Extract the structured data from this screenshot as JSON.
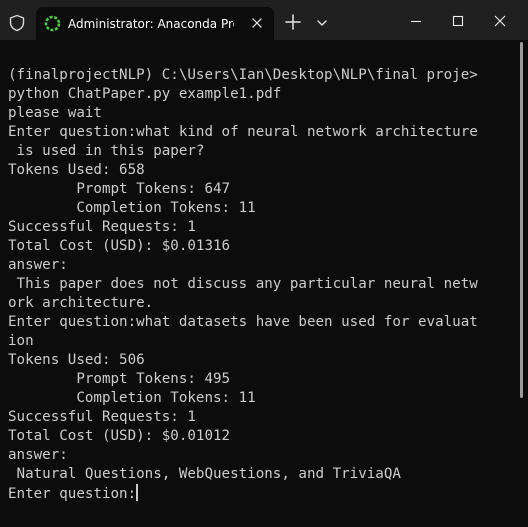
{
  "window": {
    "tab_title": "Administrator: Anaconda Prom"
  },
  "colors": {
    "titlebar": "#202020",
    "terminal_bg": "#0c0c0c",
    "terminal_text": "#cccccc",
    "tab_icon_accent": "#4ec94e"
  },
  "icons": {
    "shield": "shield-icon",
    "tab": "anaconda-icon",
    "close_tab": "close-icon",
    "new_tab": "plus-icon",
    "dropdown": "chevron-down-icon",
    "minimize": "minimize-icon",
    "maximize": "maximize-icon",
    "close_window": "close-window-icon"
  },
  "terminal": {
    "lines": [
      "(finalprojectNLP) C:\\Users\\Ian\\Desktop\\NLP\\final proje>",
      "python ChatPaper.py example1.pdf",
      "please wait",
      "Enter question:what kind of neural network architecture",
      " is used in this paper?",
      "Tokens Used: 658",
      "        Prompt Tokens: 647",
      "        Completion Tokens: 11",
      "Successful Requests: 1",
      "Total Cost (USD): $0.01316",
      "answer:",
      " This paper does not discuss any particular neural netw",
      "ork architecture.",
      "Enter question:what datasets have been used for evaluat",
      "ion",
      "Tokens Used: 506",
      "        Prompt Tokens: 495",
      "        Completion Tokens: 11",
      "Successful Requests: 1",
      "Total Cost (USD): $0.01012",
      "answer:",
      " Natural Questions, WebQuestions, and TriviaQA",
      "Enter question:"
    ]
  }
}
